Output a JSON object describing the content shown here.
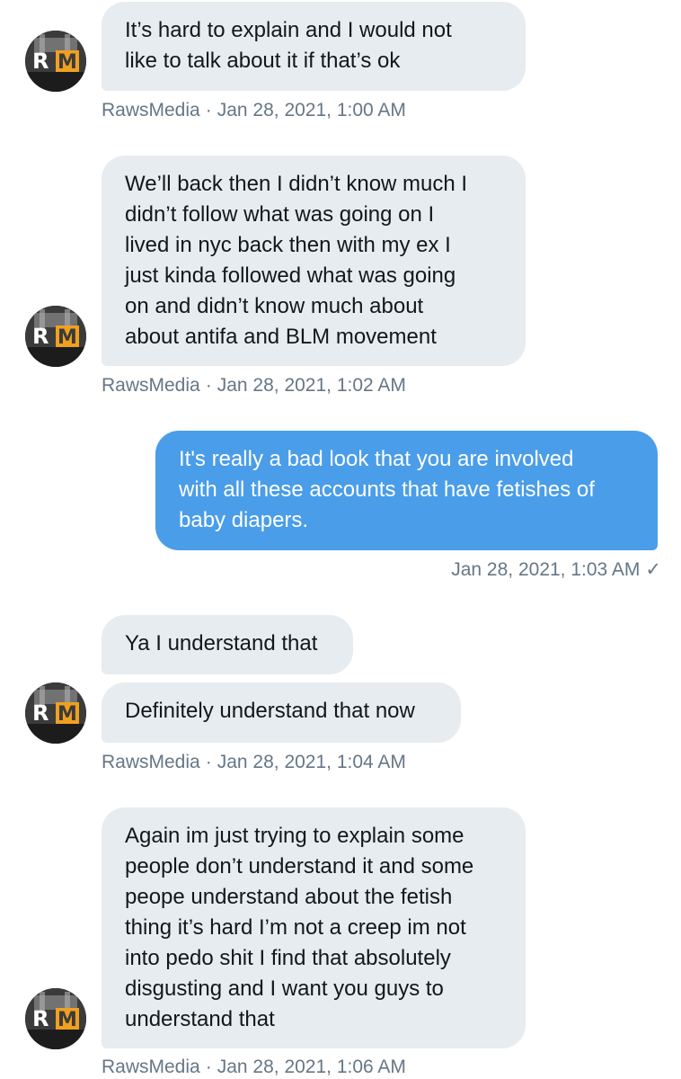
{
  "conversation": {
    "messages": [
      {
        "id": "m1",
        "direction": "in",
        "text": "It’s hard to explain and I would not\nlike to talk about it if that’s ok"
      },
      {
        "id": "m2",
        "direction": "in",
        "text": "We’ll back then I didn’t know much I\ndidn’t follow what was going on I\nlived in nyc back then with my ex I\njust kinda followed what was going\non and didn’t know much about\nabout antifa and BLM movement"
      },
      {
        "id": "m3",
        "direction": "out",
        "text": "It's really a bad look that you are involved\nwith all these accounts that have fetishes of\nbaby diapers."
      },
      {
        "id": "m4",
        "direction": "in",
        "text": "Ya I understand that"
      },
      {
        "id": "m5",
        "direction": "in",
        "text": "Definitely understand that now"
      },
      {
        "id": "m6",
        "direction": "in",
        "text": "Again im just trying to explain some\npeople don’t understand it and some\npeope understand about the fetish\nthing it’s hard I’m not a creep im not\ninto pedo shit I find that absolutely\ndisgusting and I want you guys to\nunderstand that"
      }
    ],
    "meta": [
      {
        "sender": "RawsMedia",
        "separator": "·",
        "time": "Jan 28, 2021, 1:00 AM"
      },
      {
        "sender": "RawsMedia",
        "separator": "·",
        "time": "Jan 28, 2021, 1:02 AM"
      },
      {
        "sender": "",
        "separator": "",
        "time": "Jan 28, 2021, 1:03 AM",
        "status": "✓"
      },
      {
        "sender": "RawsMedia",
        "separator": "·",
        "time": "Jan 28, 2021, 1:04 AM"
      },
      {
        "sender": "RawsMedia",
        "separator": "·",
        "time": "Jan 28, 2021, 1:06 AM"
      }
    ],
    "avatar_initials": {
      "r": "R",
      "m": "M"
    }
  },
  "colors": {
    "incoming_bubble": "#e6ecf0",
    "outgoing_bubble": "#4a9de8",
    "meta_text": "#657786",
    "avatar_m": "#f0a020"
  }
}
